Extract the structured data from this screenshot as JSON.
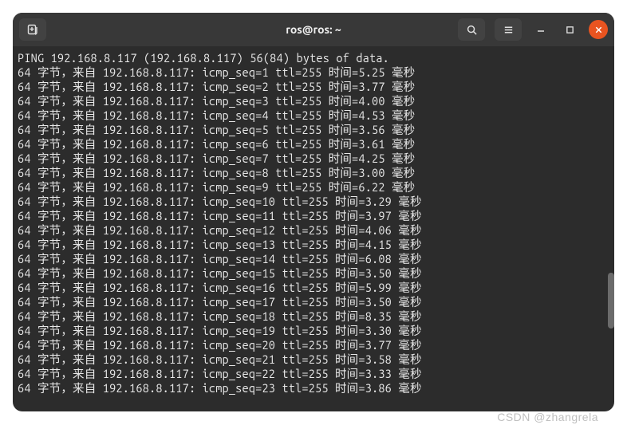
{
  "window": {
    "title": "ros@ros: ~"
  },
  "watermark": "CSDN @zhangrela",
  "ping": {
    "header": "PING 192.168.8.117 (192.168.8.117) 56(84) bytes of data.",
    "source_ip": "192.168.8.117",
    "bytes": "64",
    "ttl": "255",
    "replies": [
      {
        "seq": 1,
        "time": "5.25"
      },
      {
        "seq": 2,
        "time": "3.77"
      },
      {
        "seq": 3,
        "time": "4.00"
      },
      {
        "seq": 4,
        "time": "4.53"
      },
      {
        "seq": 5,
        "time": "3.56"
      },
      {
        "seq": 6,
        "time": "3.61"
      },
      {
        "seq": 7,
        "time": "4.25"
      },
      {
        "seq": 8,
        "time": "3.00"
      },
      {
        "seq": 9,
        "time": "6.22"
      },
      {
        "seq": 10,
        "time": "3.29"
      },
      {
        "seq": 11,
        "time": "3.97"
      },
      {
        "seq": 12,
        "time": "4.06"
      },
      {
        "seq": 13,
        "time": "4.15"
      },
      {
        "seq": 14,
        "time": "6.08"
      },
      {
        "seq": 15,
        "time": "3.50"
      },
      {
        "seq": 16,
        "time": "5.99"
      },
      {
        "seq": 17,
        "time": "3.50"
      },
      {
        "seq": 18,
        "time": "8.35"
      },
      {
        "seq": 19,
        "time": "3.30"
      },
      {
        "seq": 20,
        "time": "3.77"
      },
      {
        "seq": 21,
        "time": "3.58"
      },
      {
        "seq": 22,
        "time": "3.33"
      },
      {
        "seq": 23,
        "time": "3.86"
      }
    ],
    "labels": {
      "bytes_unit": "字节，来自",
      "time_label": "时间",
      "time_unit": "毫秒"
    }
  }
}
